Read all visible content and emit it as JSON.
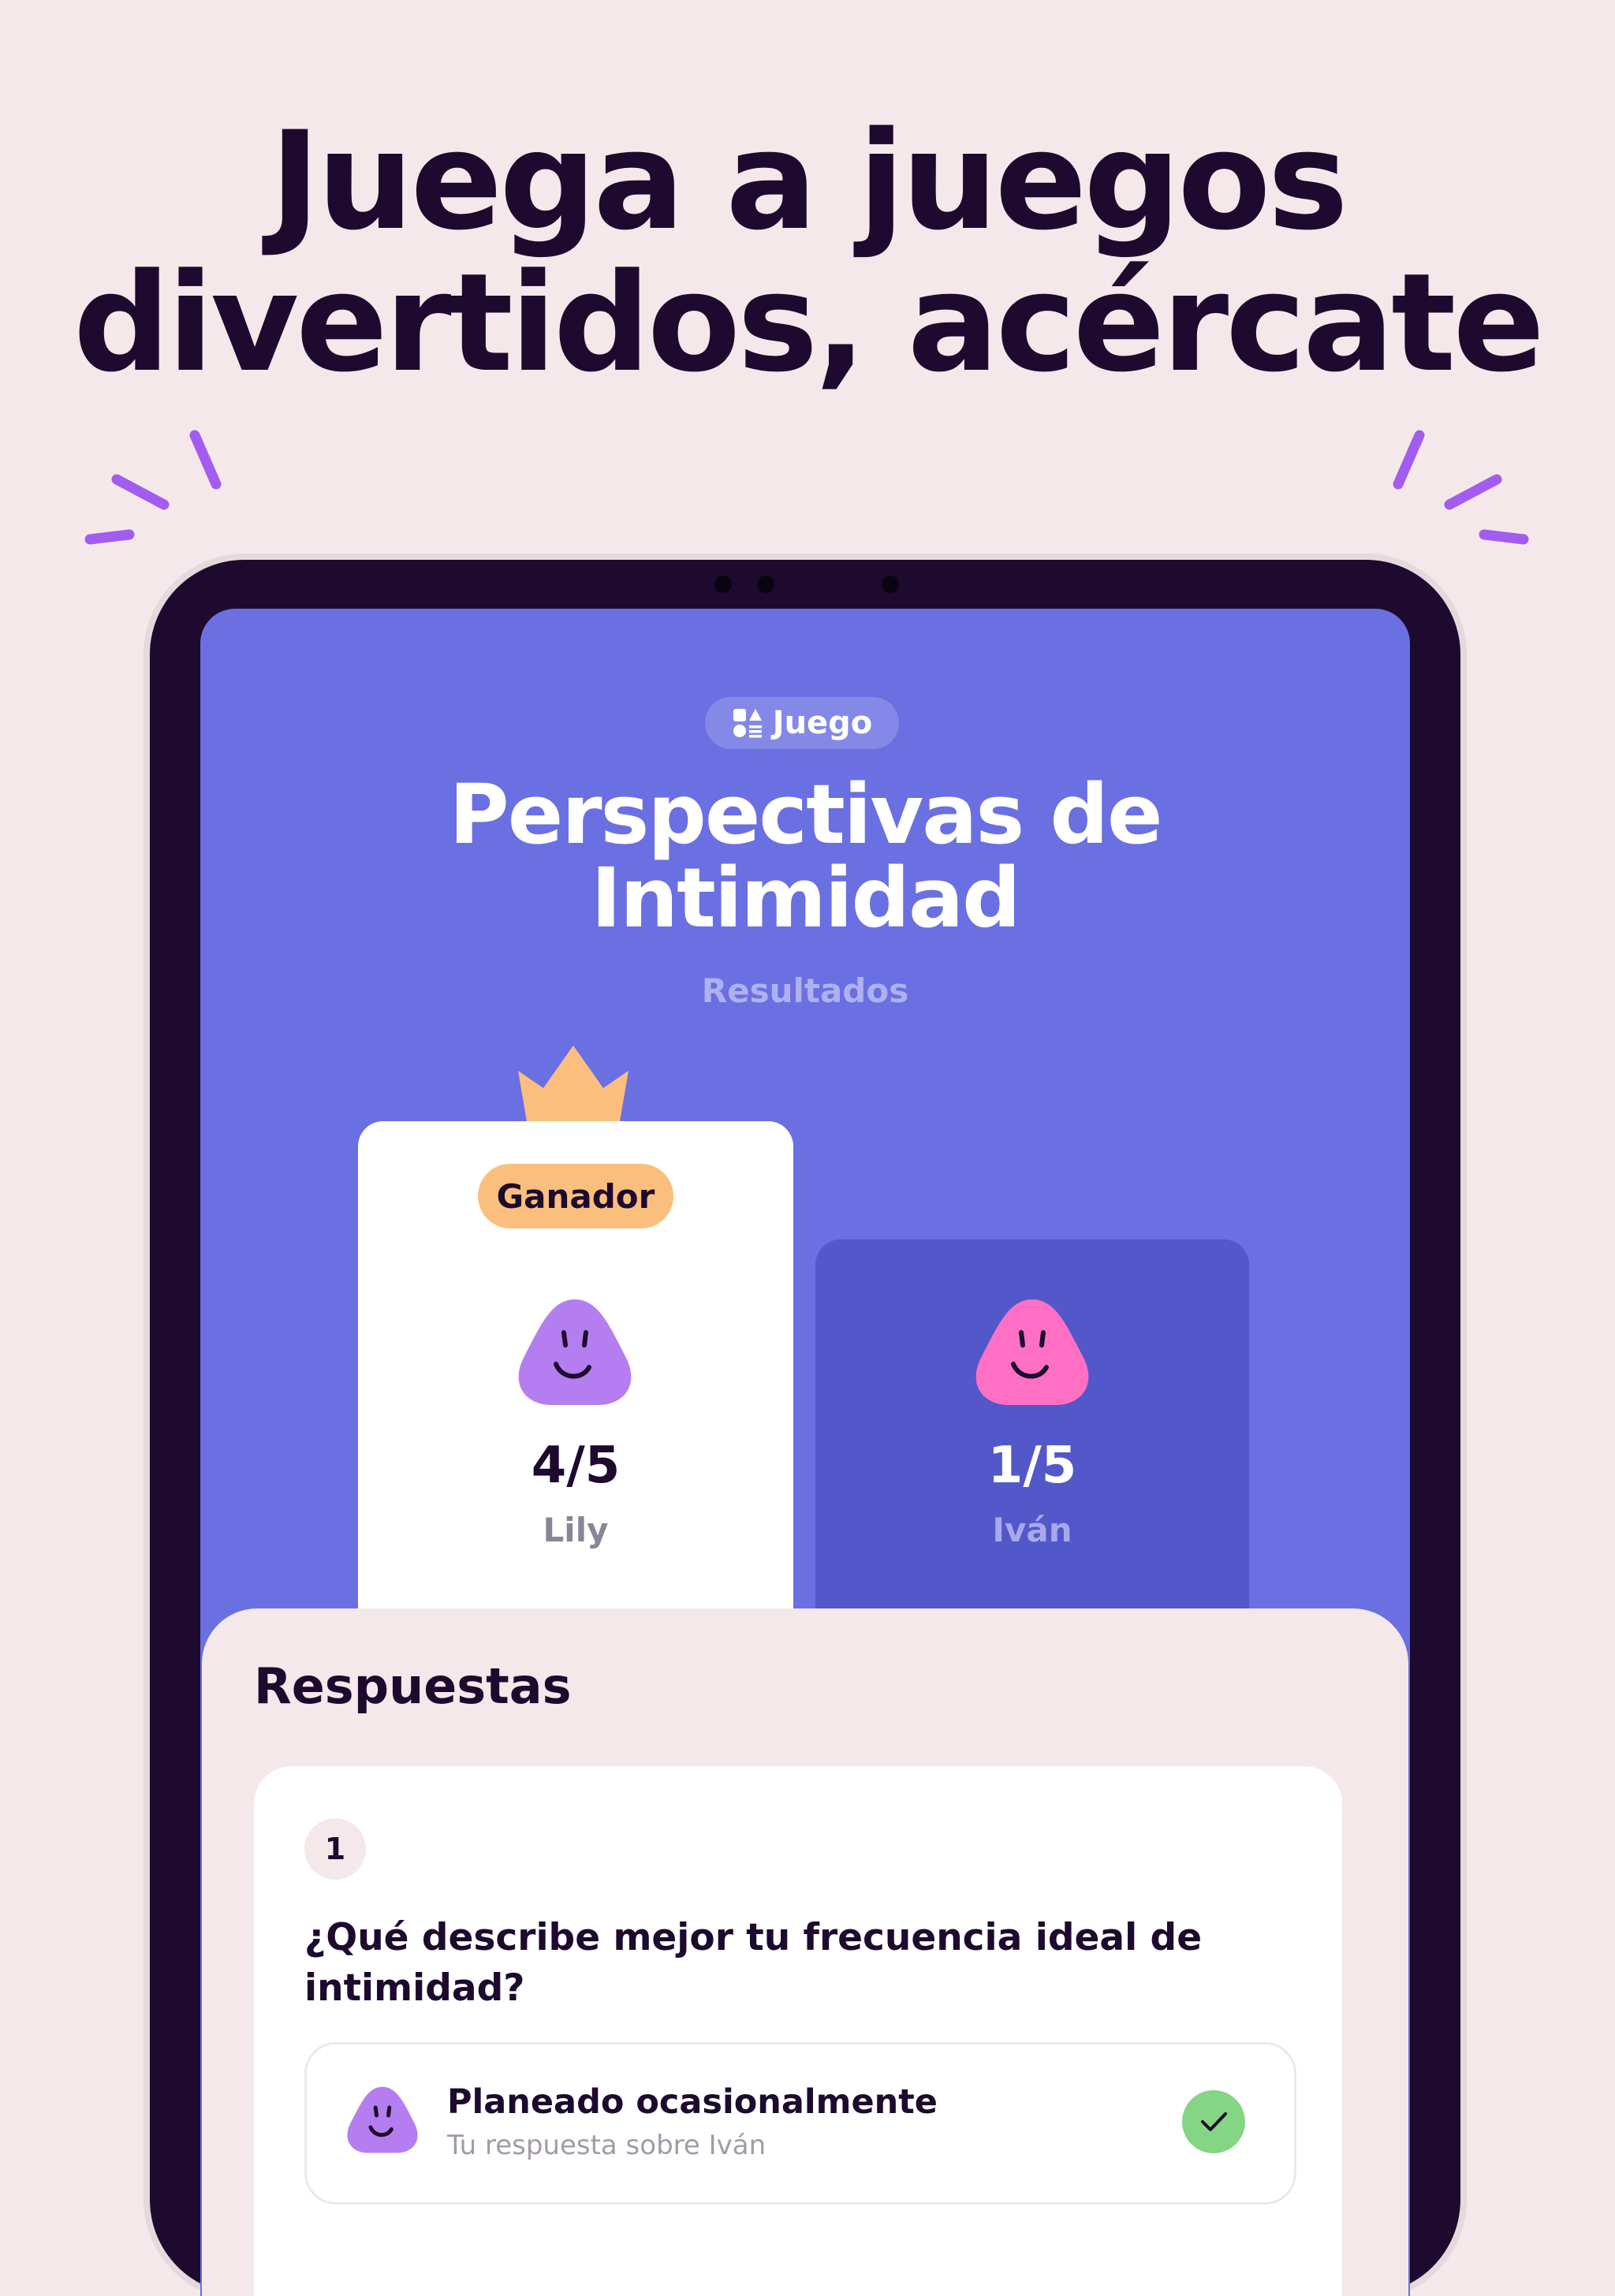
{
  "headline": {
    "line1": "Juega a juegos",
    "line2": "divertidos, acércate"
  },
  "screen": {
    "tag_label": "Juego",
    "tag_icon": "game-shapes-icon",
    "title_line1": "Perspectivas de",
    "title_line2": "Intimidad",
    "subtitle": "Resultados",
    "winner": {
      "badge": "Ganador",
      "score": "4/5",
      "name": "Lily",
      "avatar_color": "#b57ef0"
    },
    "runner_up": {
      "score": "1/5",
      "name": "Iván",
      "avatar_color": "#ff6fc4"
    },
    "answers": {
      "title": "Respuestas",
      "questions": [
        {
          "number": "1",
          "text": "¿Qué describe mejor tu frecuencia ideal de intimidad?",
          "answer": {
            "title": "Planeado ocasionalmente",
            "subtitle": "Tu respuesta sobre Iván",
            "correct": true
          }
        }
      ]
    }
  },
  "colors": {
    "background": "#f5e8ea",
    "screen": "#6a70e2",
    "ink": "#1d0a2e",
    "accent_sparkle": "#a35cf0",
    "badge": "#fbbf7d",
    "crown": "#fbbf7d",
    "check": "#84d584"
  }
}
